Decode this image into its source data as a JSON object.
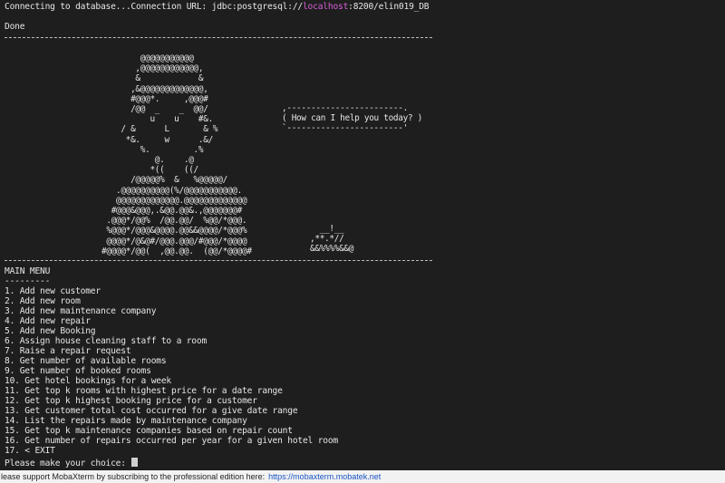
{
  "terminal": {
    "connection_prefix": "Connecting to database...Connection URL: jdbc:postgresql://",
    "connection_host": "localhost",
    "connection_suffix": ":8200/elin019_DB",
    "done": "Done",
    "ascii_art": "        @@@@@@@@@@@\n       ,@@@@@@@@@@@@,\n       &            &\n      ,&@@@@@@@@@@@@@,\n      #@@@*.     ,@@@#\n      /@@  _    _  @@/\n          u    u    #&.\n    / &      L       & %\n     *&.     w      .&/\n        %.         .%\n           @.    .@\n          *((    ((/\n      /@@@@@%  &   %@@@@@/\n   .@@@@@@@@@@(%/@@@@@@@@@@@.\n   @@@@@@@@@@@@@.@@@@@@@@@@@@@\n  #@@@&@@@,.&@@.@@&.,@@@@@@@#\n .@@@*/@@%  /@@.@@/  %@@/*@@@.\n %@@@*/@@@&@@@@.@@&&@@@@/*@@@%\n @@@@*/@&@#/@@@.@@@/#@@@/*@@@@\n#@@@@*/@@(  ,@@.@@.  (@@/*@@@@#",
    "speech_bubble": ",------------------------.\n( How can I help you today? )\n`------------------------'",
    "small_art": "  __!__\n,**.*//\n&&%%%%&&@",
    "menu_title": "MAIN MENU",
    "menu_underline": "---------",
    "menu_items": [
      "1. Add new customer",
      "2. Add new room",
      "3. Add new maintenance company",
      "4. Add new repair",
      "5. Add new Booking",
      "6. Assign house cleaning staff to a room",
      "7. Raise a repair request",
      "8. Get number of available rooms",
      "9. Get number of booked rooms",
      "10. Get hotel bookings for a week",
      "11. Get top k rooms with highest price for a date range",
      "12. Get top k highest booking price for a customer",
      "13. Get customer total cost occurred for a give date range",
      "14. List the repairs made by maintenance company",
      "15. Get top k maintenance companies based on repair count",
      "16. Get number of repairs occurred per year for a given hotel room",
      "17. < EXIT"
    ],
    "prompt": "Please make your choice: "
  },
  "status_bar": {
    "message": "lease support MobaXterm by subscribing to the professional edition here:",
    "link": "https://mobaxterm.mobatek.net"
  },
  "colors": {
    "background": "#1e1e1e",
    "text": "#e6e6e6",
    "host_highlight": "#d95fd9",
    "link": "#1a55c4"
  }
}
